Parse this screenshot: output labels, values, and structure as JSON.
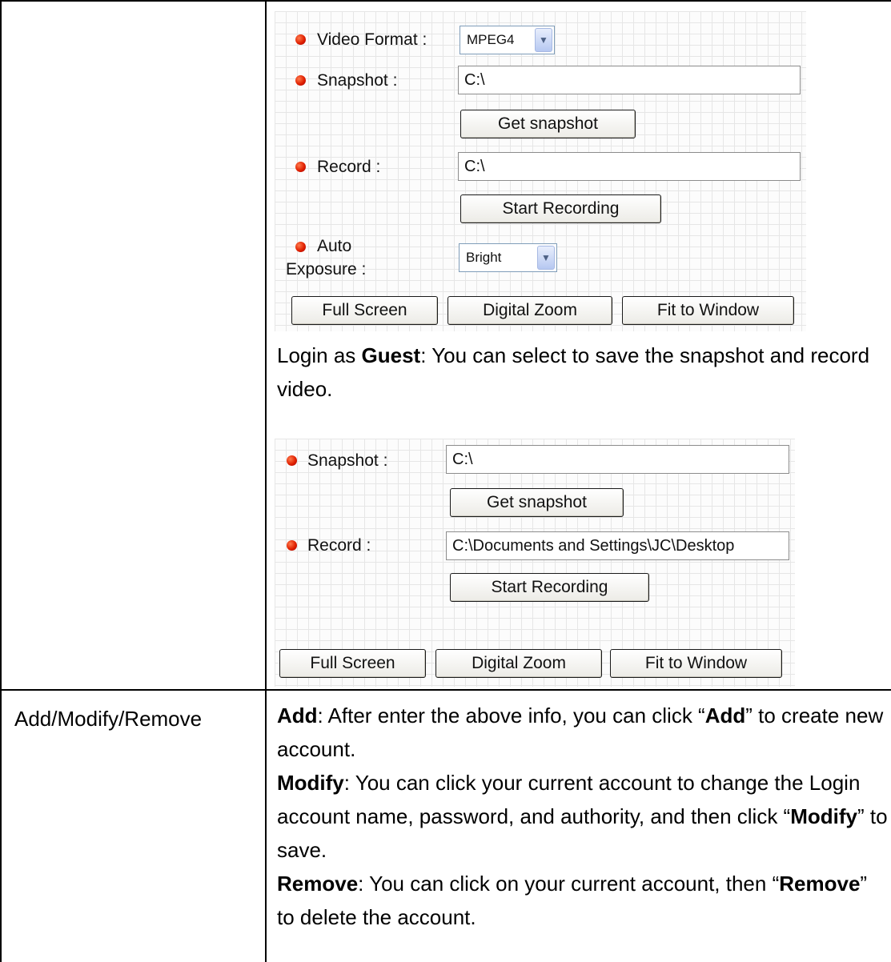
{
  "table": {
    "row2_label": "Add/Modify/Remove"
  },
  "admin_panel": {
    "video_format_label": "Video Format :",
    "video_format_value": "MPEG4",
    "snapshot_label": "Snapshot :",
    "snapshot_path": "C:\\",
    "get_snapshot_label": "Get snapshot",
    "record_label": "Record :",
    "record_path": "C:\\",
    "start_recording_label": "Start Recording",
    "auto_exposure_label_line1": "Auto",
    "auto_exposure_label_line2": "Exposure :",
    "auto_exposure_value": "Bright",
    "full_screen_label": "Full Screen",
    "digital_zoom_label": "Digital Zoom",
    "fit_to_window_label": "Fit to Window"
  },
  "guest_text": {
    "prefix": "Login as ",
    "bold": "Guest",
    "suffix": ": You can select to save the snapshot and record video."
  },
  "guest_panel": {
    "snapshot_label": "Snapshot :",
    "snapshot_path": "C:\\",
    "get_snapshot_label": "Get snapshot",
    "record_label": "Record :",
    "record_path": "C:\\Documents and Settings\\JC\\Desktop",
    "start_recording_label": "Start Recording",
    "full_screen_label": "Full Screen",
    "digital_zoom_label": "Digital Zoom",
    "fit_to_window_label": "Fit to Window"
  },
  "description": {
    "add_term": "Add",
    "add_text_1": ": After enter the above info, you can click “",
    "add_quoted": "Add",
    "add_text_2": "” to create new account.",
    "modify_term": "Modify",
    "modify_text_1": ": You can click your current account to change the Login account name, password, and authority, and then click “",
    "modify_quoted": "Modify",
    "modify_text_2": "” to save.",
    "remove_term": "Remove",
    "remove_text_1": ": You can click on your current account, then “",
    "remove_quoted": "Remove",
    "remove_text_2": "” to delete the account."
  }
}
